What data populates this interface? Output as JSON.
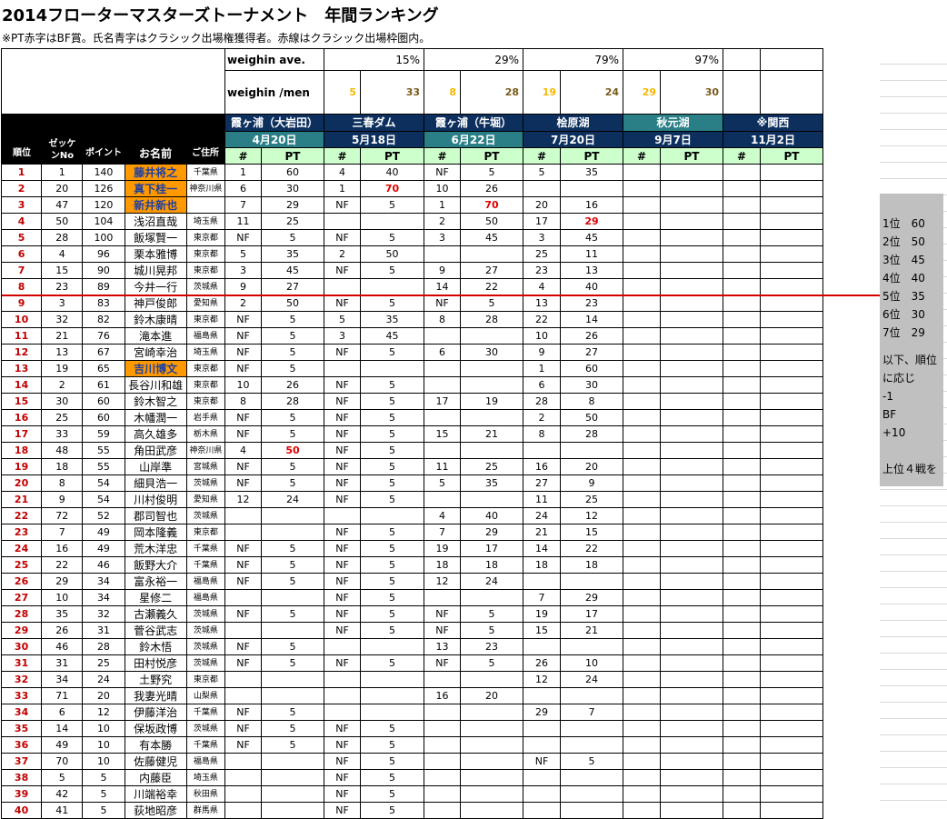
{
  "title": "2014フローターマスターズトーナメント　年間ランキング",
  "note": "※PT赤字はBF賞。氏名青字はクラシック出場権獲得者。赤線はクラシック出場枠圏内。",
  "weighin_ave_label": "weighin ave.",
  "weighin_men_label": "weighin /men",
  "weighin_pct": [
    "15%",
    "29%",
    "79%",
    "97%"
  ],
  "weighin_counts": [
    [
      "5",
      "33"
    ],
    [
      "8",
      "28"
    ],
    [
      "19",
      "24"
    ],
    [
      "29",
      "30"
    ]
  ],
  "headers": {
    "rank": "順位",
    "zekken": "ゼッケンNo",
    "points": "ポイント",
    "name": "お名前",
    "address": "ご住所"
  },
  "events": [
    {
      "lake": "霞ヶ浦（大岩田）",
      "date": "4月20日"
    },
    {
      "lake": "三春ダム",
      "date": "5月18日"
    },
    {
      "lake": "霞ヶ浦（牛堀）",
      "date": "6月22日"
    },
    {
      "lake": "桧原湖",
      "date": "7月20日"
    },
    {
      "lake": "秋元湖",
      "date": "9月7日"
    },
    {
      "lake": "※関西",
      "date": "11月2日"
    }
  ],
  "subheader": {
    "num": "#",
    "pt": "PT"
  },
  "rows": [
    [
      "1",
      "1",
      "140",
      "藤井将之",
      "千葉県",
      "1",
      "60",
      "4",
      "40",
      "NF",
      "5",
      "5",
      "35"
    ],
    [
      "2",
      "20",
      "126",
      "真下桂一",
      "神奈川県",
      "6",
      "30",
      "1",
      "70",
      "10",
      "26",
      "",
      ""
    ],
    [
      "3",
      "47",
      "120",
      "新井新也",
      "",
      "7",
      "29",
      "NF",
      "5",
      "1",
      "70",
      "20",
      "16"
    ],
    [
      "4",
      "50",
      "104",
      "浅沼直哉",
      "埼玉県",
      "11",
      "25",
      "",
      "",
      "2",
      "50",
      "17",
      "29"
    ],
    [
      "5",
      "28",
      "100",
      "飯塚賢一",
      "東京都",
      "NF",
      "5",
      "NF",
      "5",
      "3",
      "45",
      "3",
      "45"
    ],
    [
      "6",
      "4",
      "96",
      "栗本雅博",
      "東京都",
      "5",
      "35",
      "2",
      "50",
      "",
      "",
      "25",
      "11"
    ],
    [
      "7",
      "15",
      "90",
      "城川晃邦",
      "東京都",
      "3",
      "45",
      "NF",
      "5",
      "9",
      "27",
      "23",
      "13"
    ],
    [
      "8",
      "23",
      "89",
      "今井一行",
      "茨城県",
      "9",
      "27",
      "",
      "",
      "14",
      "22",
      "4",
      "40"
    ],
    [
      "9",
      "3",
      "83",
      "神戸俊郎",
      "愛知県",
      "2",
      "50",
      "NF",
      "5",
      "NF",
      "5",
      "13",
      "23"
    ],
    [
      "10",
      "32",
      "82",
      "鈴木康晴",
      "東京都",
      "NF",
      "5",
      "5",
      "35",
      "8",
      "28",
      "22",
      "14"
    ],
    [
      "11",
      "21",
      "76",
      "滝本進",
      "福島県",
      "NF",
      "5",
      "3",
      "45",
      "",
      "",
      "10",
      "26"
    ],
    [
      "12",
      "13",
      "67",
      "宮崎幸治",
      "埼玉県",
      "NF",
      "5",
      "NF",
      "5",
      "6",
      "30",
      "9",
      "27"
    ],
    [
      "13",
      "19",
      "65",
      "吉川博文",
      "東京都",
      "NF",
      "5",
      "",
      "",
      "",
      "",
      "1",
      "60"
    ],
    [
      "14",
      "2",
      "61",
      "長谷川和雄",
      "東京都",
      "10",
      "26",
      "NF",
      "5",
      "",
      "",
      "6",
      "30"
    ],
    [
      "15",
      "30",
      "60",
      "鈴木智之",
      "東京都",
      "8",
      "28",
      "NF",
      "5",
      "17",
      "19",
      "28",
      "8"
    ],
    [
      "16",
      "25",
      "60",
      "木幡潤一",
      "岩手県",
      "NF",
      "5",
      "NF",
      "5",
      "",
      "",
      "2",
      "50"
    ],
    [
      "17",
      "33",
      "59",
      "高久雄多",
      "栃木県",
      "NF",
      "5",
      "NF",
      "5",
      "15",
      "21",
      "8",
      "28"
    ],
    [
      "18",
      "48",
      "55",
      "角田武彦",
      "神奈川県",
      "4",
      "50",
      "NF",
      "5",
      "",
      "",
      "",
      ""
    ],
    [
      "19",
      "18",
      "55",
      "山岸準",
      "宮城県",
      "NF",
      "5",
      "NF",
      "5",
      "11",
      "25",
      "16",
      "20"
    ],
    [
      "20",
      "8",
      "54",
      "細貝浩一",
      "茨城県",
      "NF",
      "5",
      "NF",
      "5",
      "5",
      "35",
      "27",
      "9"
    ],
    [
      "21",
      "9",
      "54",
      "川村俊明",
      "愛知県",
      "12",
      "24",
      "NF",
      "5",
      "",
      "",
      "11",
      "25"
    ],
    [
      "22",
      "72",
      "52",
      "郡司智也",
      "茨城県",
      "",
      "",
      "",
      "",
      "4",
      "40",
      "24",
      "12"
    ],
    [
      "23",
      "7",
      "49",
      "岡本隆義",
      "東京都",
      "",
      "",
      "NF",
      "5",
      "7",
      "29",
      "21",
      "15"
    ],
    [
      "24",
      "16",
      "49",
      "荒木洋忠",
      "千葉県",
      "NF",
      "5",
      "NF",
      "5",
      "19",
      "17",
      "14",
      "22"
    ],
    [
      "25",
      "22",
      "46",
      "飯野大介",
      "千葉県",
      "NF",
      "5",
      "NF",
      "5",
      "18",
      "18",
      "18",
      "18"
    ],
    [
      "26",
      "29",
      "34",
      "富永裕一",
      "福島県",
      "NF",
      "5",
      "NF",
      "5",
      "12",
      "24",
      "",
      ""
    ],
    [
      "27",
      "10",
      "34",
      "星修二",
      "福島県",
      "",
      "",
      "NF",
      "5",
      "",
      "",
      "7",
      "29"
    ],
    [
      "28",
      "35",
      "32",
      "古瀬義久",
      "茨城県",
      "NF",
      "5",
      "NF",
      "5",
      "NF",
      "5",
      "19",
      "17"
    ],
    [
      "29",
      "26",
      "31",
      "菅谷武志",
      "茨城県",
      "",
      "",
      "NF",
      "5",
      "NF",
      "5",
      "15",
      "21"
    ],
    [
      "30",
      "46",
      "28",
      "鈴木悟",
      "茨城県",
      "NF",
      "5",
      "",
      "",
      "13",
      "23",
      "",
      ""
    ],
    [
      "31",
      "31",
      "25",
      "田村悦彦",
      "茨城県",
      "NF",
      "5",
      "NF",
      "5",
      "NF",
      "5",
      "26",
      "10"
    ],
    [
      "32",
      "34",
      "24",
      "土野究",
      "東京都",
      "",
      "",
      "",
      "",
      "",
      "",
      "12",
      "24"
    ],
    [
      "33",
      "71",
      "20",
      "我妻光晴",
      "山梨県",
      "",
      "",
      "",
      "",
      "16",
      "20",
      "",
      ""
    ],
    [
      "34",
      "6",
      "12",
      "伊藤洋治",
      "千葉県",
      "NF",
      "5",
      "",
      "",
      "",
      "",
      "29",
      "7"
    ],
    [
      "35",
      "14",
      "10",
      "保坂政博",
      "茨城県",
      "NF",
      "5",
      "NF",
      "5",
      "",
      "",
      "",
      ""
    ],
    [
      "36",
      "49",
      "10",
      "有本勝",
      "千葉県",
      "NF",
      "5",
      "NF",
      "5",
      "",
      "",
      "",
      ""
    ],
    [
      "37",
      "70",
      "10",
      "佐藤健児",
      "福島県",
      "",
      "",
      "NF",
      "5",
      "",
      "",
      "NF",
      "5"
    ],
    [
      "38",
      "5",
      "5",
      "内藤臣",
      "埼玉県",
      "",
      "",
      "NF",
      "5",
      "",
      "",
      "",
      ""
    ],
    [
      "39",
      "42",
      "5",
      "川端裕幸",
      "秋田県",
      "",
      "",
      "NF",
      "5",
      "",
      "",
      "",
      ""
    ],
    [
      "40",
      "41",
      "5",
      "荻地昭彦",
      "群馬県",
      "",
      "",
      "NF",
      "5",
      "",
      "",
      "",
      ""
    ]
  ],
  "orange_names": [
    1,
    2,
    3,
    13
  ],
  "red_points": [
    [
      2,
      8
    ],
    [
      3,
      10
    ],
    [
      4,
      12
    ],
    [
      18,
      6
    ]
  ],
  "colors": {
    "orange_name_bg": "#ff9900",
    "qualified_name_text": "#1f3fa0",
    "bf_red": "#e00000",
    "cutline": "#d10000"
  },
  "side": {
    "ranks": [
      "1位　60",
      "2位　50",
      "3位　45",
      "4位　40",
      "5位　35",
      "6位　30",
      "7位　29"
    ],
    "notes": [
      "以下、順位",
      "に応じ",
      "-1",
      "BF",
      "+10",
      "",
      "上位４戦を"
    ]
  }
}
